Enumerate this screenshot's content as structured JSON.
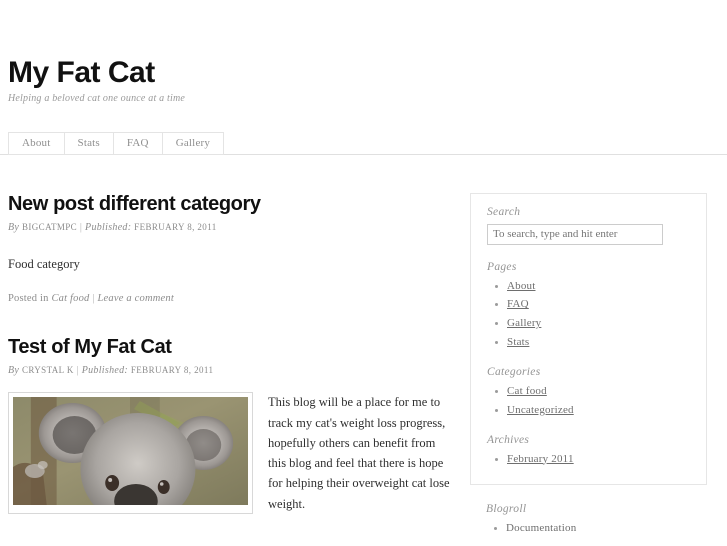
{
  "site": {
    "title": "My Fat Cat",
    "description": "Helping a beloved cat one ounce at a time"
  },
  "nav": {
    "items": [
      {
        "label": "About"
      },
      {
        "label": "Stats"
      },
      {
        "label": "FAQ"
      },
      {
        "label": "Gallery"
      }
    ]
  },
  "posts": [
    {
      "title": "New post different category",
      "meta": {
        "by_label": "By",
        "author": "BIGCATMPC",
        "separator": "|",
        "published_label": "Published:",
        "date": "February 8, 2011"
      },
      "body": "Food category",
      "footer": {
        "posted_in_label": "Posted in",
        "category": "Cat food",
        "separator": "|",
        "comment_link": "Leave a comment"
      }
    },
    {
      "title": "Test of My Fat Cat",
      "meta": {
        "by_label": "By",
        "author": "CRYSTAL K",
        "separator": "|",
        "published_label": "Published:",
        "date": "February 8, 2011"
      },
      "image_alt": "koala-photo",
      "body": "This blog will be a place for me to track my cat's weight loss progress, hopefully others can benefit from this blog and feel that there is hope for helping their overweight cat lose weight."
    }
  ],
  "sidebar": {
    "search": {
      "title": "Search",
      "placeholder": "To search, type and hit enter",
      "value": ""
    },
    "pages": {
      "title": "Pages",
      "items": [
        {
          "label": "About"
        },
        {
          "label": "FAQ"
        },
        {
          "label": "Gallery"
        },
        {
          "label": "Stats"
        }
      ]
    },
    "categories": {
      "title": "Categories",
      "items": [
        {
          "label": "Cat food"
        },
        {
          "label": "Uncategorized"
        }
      ]
    },
    "archives": {
      "title": "Archives",
      "items": [
        {
          "label": "February 2011"
        }
      ]
    },
    "blogroll": {
      "title": "Blogroll",
      "items": [
        {
          "label": "Documentation"
        }
      ]
    }
  },
  "colors": {
    "text": "#333333",
    "muted": "#8c8c8c",
    "border": "#e6e6e6",
    "link": "#6e6e6e"
  }
}
